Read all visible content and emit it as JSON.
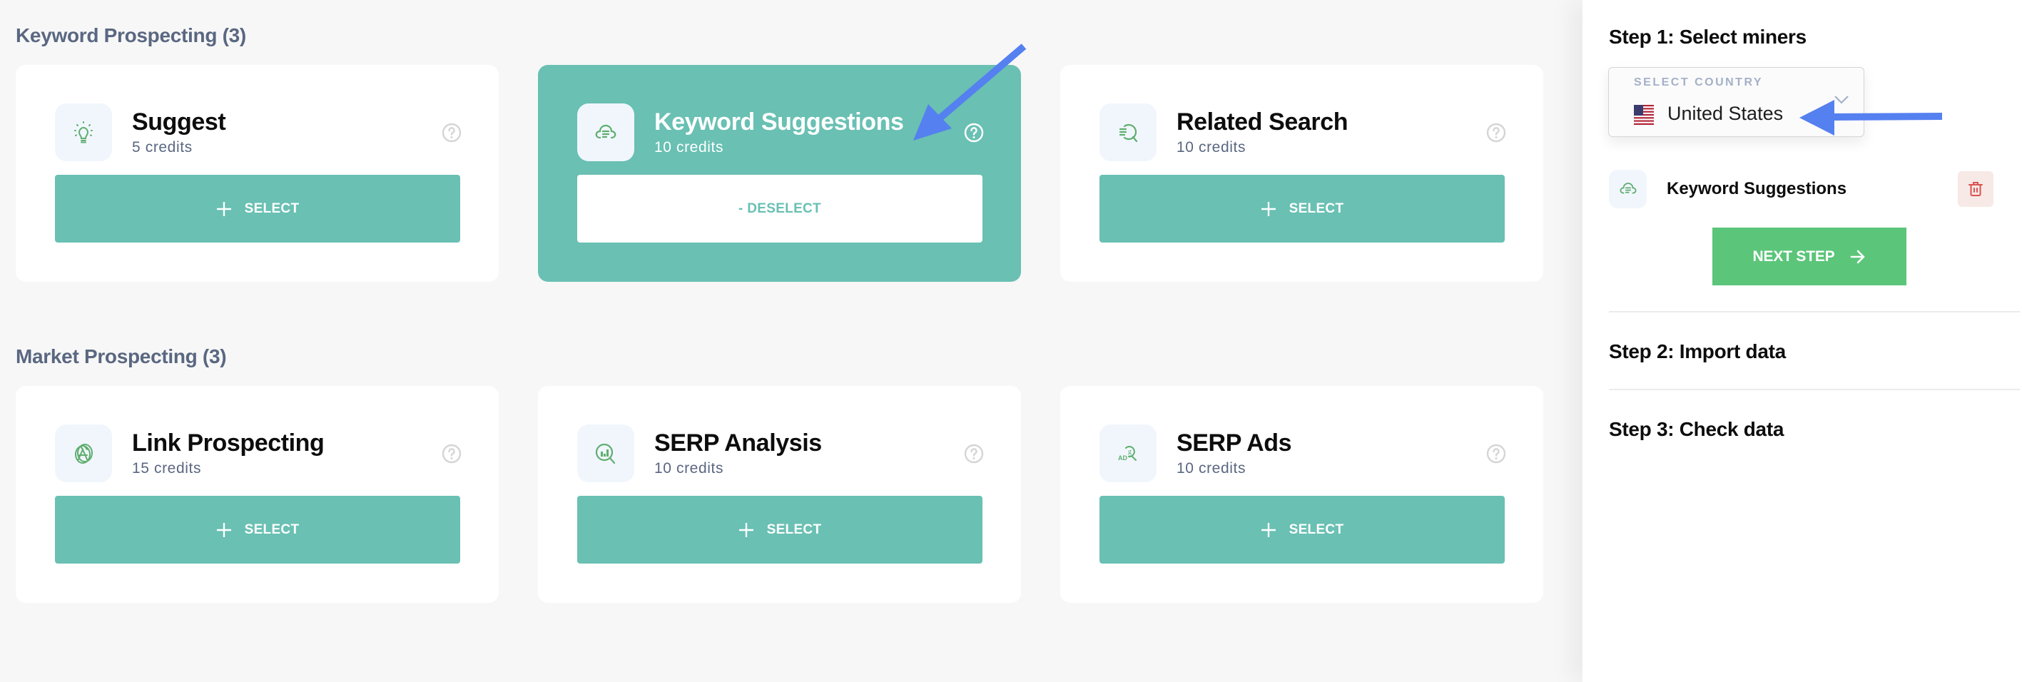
{
  "sections": [
    {
      "heading": "Keyword Prospecting (3)",
      "miners": [
        {
          "name": "Suggest",
          "credits": "5 credits",
          "icon": "lightbulb-icon",
          "selected": false,
          "button_label": "SELECT"
        },
        {
          "name": "Keyword Suggestions",
          "credits": "10 credits",
          "icon": "cloud-list-icon",
          "selected": true,
          "button_label": "- DESELECT"
        },
        {
          "name": "Related Search",
          "credits": "10 credits",
          "icon": "list-search-icon",
          "selected": false,
          "button_label": "SELECT"
        }
      ]
    },
    {
      "heading": "Market Prospecting (3)",
      "miners": [
        {
          "name": "Link Prospecting",
          "credits": "15 credits",
          "icon": "link-globe-icon",
          "selected": false,
          "button_label": "SELECT"
        },
        {
          "name": "SERP Analysis",
          "credits": "10 credits",
          "icon": "chart-search-icon",
          "selected": false,
          "button_label": "SELECT"
        },
        {
          "name": "SERP Ads",
          "credits": "10 credits",
          "icon": "ad-search-icon",
          "selected": false,
          "button_label": "SELECT"
        }
      ]
    }
  ],
  "panel": {
    "step1_title": "Step 1: Select miners",
    "country_select": {
      "label": "SELECT COUNTRY",
      "value": "United States",
      "flag": "us-flag-icon"
    },
    "selected_miners": [
      {
        "name": "Keyword Suggestions",
        "icon": "cloud-list-icon"
      }
    ],
    "next_button": "NEXT STEP",
    "step2_title": "Step 2: Import data",
    "step3_title": "Step 3: Check data"
  },
  "colors": {
    "accent_teal": "#69c0b3",
    "next_green": "#5bc57a",
    "heading_slate": "#5a6781",
    "icon_green": "#5fae6f",
    "trash_red": "#d9534f",
    "annotation_blue": "#5580f0"
  }
}
